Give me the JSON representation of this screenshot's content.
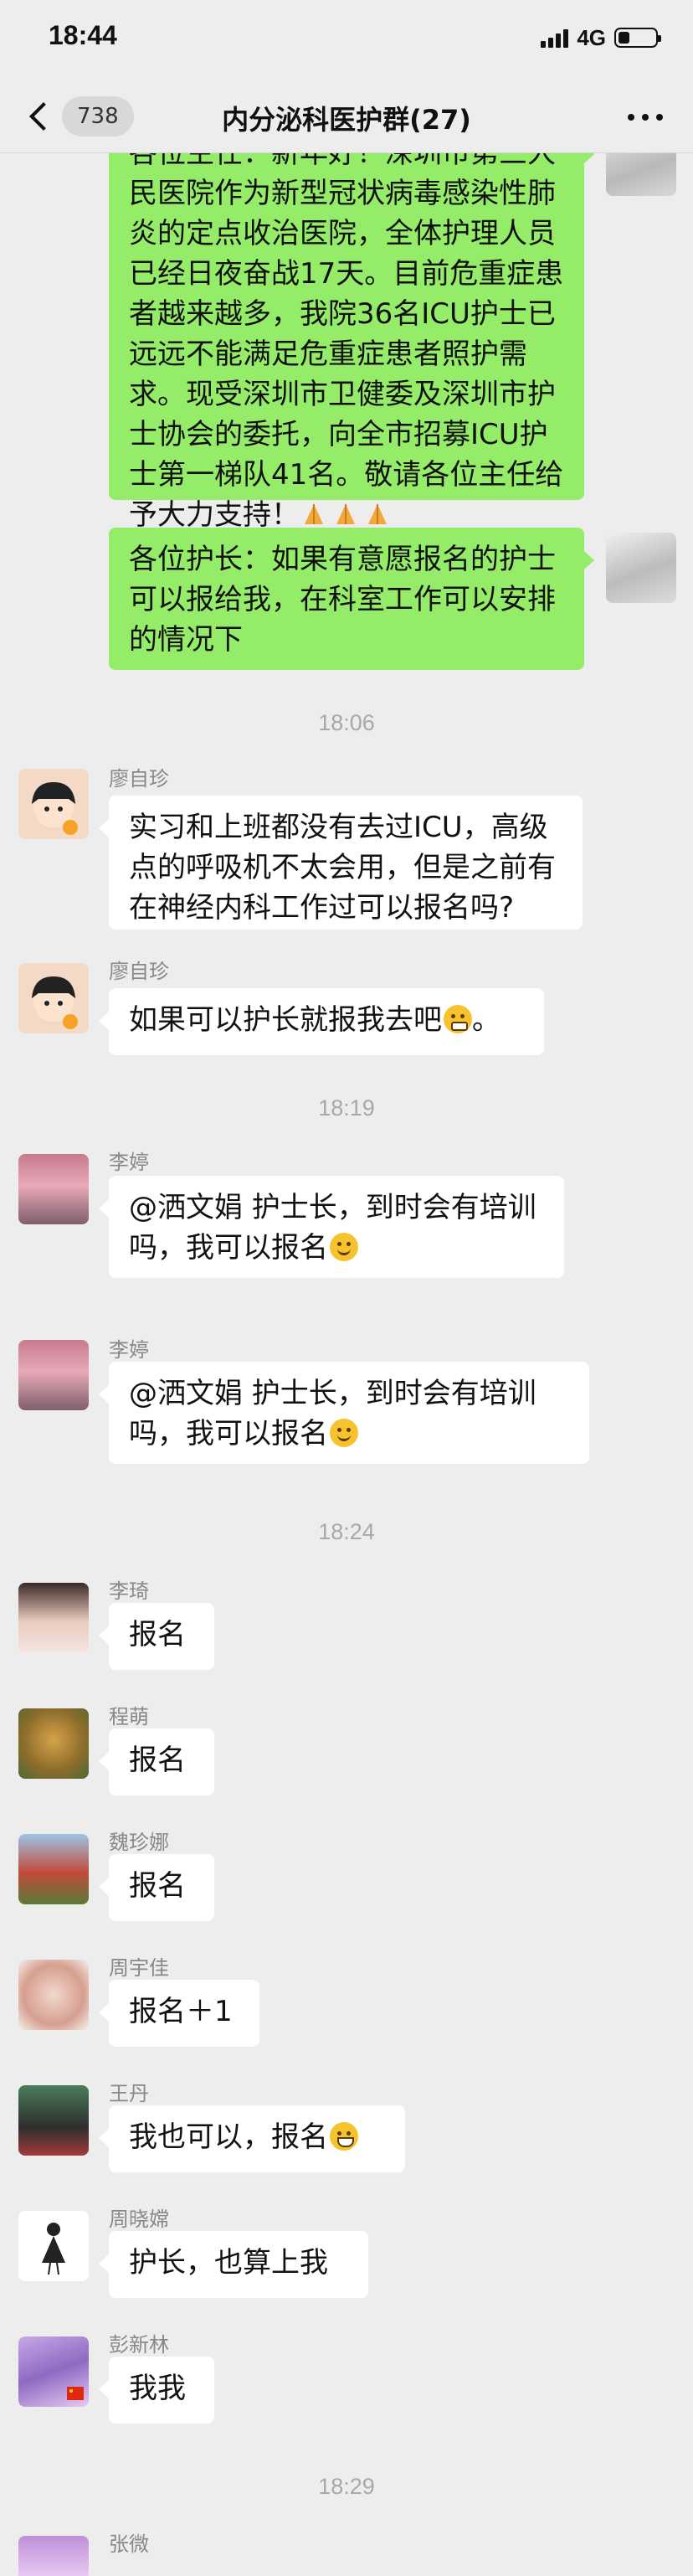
{
  "status_bar": {
    "time": "18:44",
    "network": "4G",
    "battery_level": 0.3
  },
  "header": {
    "back_count": "738",
    "title": "内分泌科医护群(27)"
  },
  "messages": {
    "m0": {
      "text": "各位主任：新年好！深圳市第三人民医院作为新型冠状病毒感染性肺炎的定点收治医院，全体护理人员已经日夜奋战17天。目前危重症患者越来越多，我院36名ICU护士已远远不能满足危重症患者照护需求。现受深圳市卫健委及深圳市护士协会的委托，向全市招募ICU护士第一梯队41名。敬请各位主任给予大力支持！"
    },
    "m1": {
      "text": "各位护长：如果有意愿报名的护士可以报给我，在科室工作可以安排的情况下"
    },
    "t1": "18:06",
    "m2": {
      "sender": "廖自珍",
      "text": "实习和上班都没有去过ICU，高级点的呼吸机不太会用，但是之前有在神经内科工作过可以报名吗?"
    },
    "m3": {
      "sender": "廖自珍",
      "text": "如果可以护长就报我去吧",
      "text_after": "。"
    },
    "t2": "18:19",
    "m4": {
      "sender": "李婷",
      "text": "@洒文娟 护士长，到时会有培训吗，我可以报名"
    },
    "m5": {
      "sender": "李婷",
      "text": "@洒文娟 护士长，到时会有培训吗，我可以报名"
    },
    "t3": "18:24",
    "m6": {
      "sender": "李琦",
      "text": "报名"
    },
    "m7": {
      "sender": "程萌",
      "text": "报名"
    },
    "m8": {
      "sender": "魏珍娜",
      "text": "报名"
    },
    "m9": {
      "sender": "周宇佳",
      "text": "报名＋1"
    },
    "m10": {
      "sender": "王丹",
      "text": "我也可以，报名"
    },
    "m11": {
      "sender": "周晓嫦",
      "text": "护长，也算上我"
    },
    "m12": {
      "sender": "彭新林",
      "text": "我我"
    },
    "t4": "18:29",
    "m13": {
      "sender": "张微"
    }
  },
  "colors": {
    "background": "#ededed",
    "outgoing_bubble": "#95ec69",
    "incoming_bubble": "#ffffff"
  }
}
